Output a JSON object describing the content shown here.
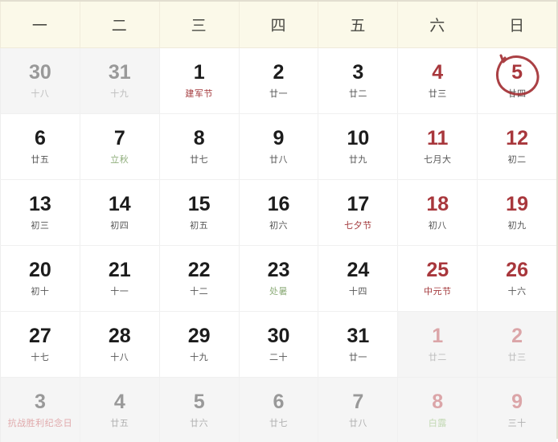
{
  "calendar": {
    "weekdays": [
      "一",
      "二",
      "三",
      "四",
      "五",
      "六",
      "日"
    ],
    "colors": {
      "header_bg": "#fbf9e9",
      "weekend_red": "#a8373c",
      "festival_red": "#a3393c",
      "solarterm_green": "#8fae7c",
      "other_month_bg": "#f5f5f5",
      "highlight_circle": "#a33034"
    },
    "highlight": {
      "day": "5",
      "type": "circle-annotation"
    },
    "weeks": [
      [
        {
          "num": "30",
          "sub": "十八",
          "num_style": "muted",
          "sub_style": "muted",
          "other_month": true,
          "marked": false
        },
        {
          "num": "31",
          "sub": "十九",
          "num_style": "muted",
          "sub_style": "muted",
          "other_month": true,
          "marked": false
        },
        {
          "num": "1",
          "sub": "建军节",
          "num_style": "normal",
          "sub_style": "festival",
          "other_month": false,
          "marked": false
        },
        {
          "num": "2",
          "sub": "廿一",
          "num_style": "normal",
          "sub_style": "plain",
          "other_month": false,
          "marked": false
        },
        {
          "num": "3",
          "sub": "廿二",
          "num_style": "normal",
          "sub_style": "plain",
          "other_month": false,
          "marked": false
        },
        {
          "num": "4",
          "sub": "廿三",
          "num_style": "weekend",
          "sub_style": "plain",
          "other_month": false,
          "marked": false
        },
        {
          "num": "5",
          "sub": "廿四",
          "num_style": "weekend",
          "sub_style": "plain",
          "other_month": false,
          "marked": true
        }
      ],
      [
        {
          "num": "6",
          "sub": "廿五",
          "num_style": "normal",
          "sub_style": "plain",
          "other_month": false,
          "marked": false
        },
        {
          "num": "7",
          "sub": "立秋",
          "num_style": "normal",
          "sub_style": "solarterm",
          "other_month": false,
          "marked": false
        },
        {
          "num": "8",
          "sub": "廿七",
          "num_style": "normal",
          "sub_style": "plain",
          "other_month": false,
          "marked": false
        },
        {
          "num": "9",
          "sub": "廿八",
          "num_style": "normal",
          "sub_style": "plain",
          "other_month": false,
          "marked": false
        },
        {
          "num": "10",
          "sub": "廿九",
          "num_style": "normal",
          "sub_style": "plain",
          "other_month": false,
          "marked": false
        },
        {
          "num": "11",
          "sub": "七月大",
          "num_style": "weekend",
          "sub_style": "plain",
          "other_month": false,
          "marked": false
        },
        {
          "num": "12",
          "sub": "初二",
          "num_style": "weekend",
          "sub_style": "plain",
          "other_month": false,
          "marked": false
        }
      ],
      [
        {
          "num": "13",
          "sub": "初三",
          "num_style": "normal",
          "sub_style": "plain",
          "other_month": false,
          "marked": false
        },
        {
          "num": "14",
          "sub": "初四",
          "num_style": "normal",
          "sub_style": "plain",
          "other_month": false,
          "marked": false
        },
        {
          "num": "15",
          "sub": "初五",
          "num_style": "normal",
          "sub_style": "plain",
          "other_month": false,
          "marked": false
        },
        {
          "num": "16",
          "sub": "初六",
          "num_style": "normal",
          "sub_style": "plain",
          "other_month": false,
          "marked": false
        },
        {
          "num": "17",
          "sub": "七夕节",
          "num_style": "normal",
          "sub_style": "festival",
          "other_month": false,
          "marked": false
        },
        {
          "num": "18",
          "sub": "初八",
          "num_style": "weekend",
          "sub_style": "plain",
          "other_month": false,
          "marked": false
        },
        {
          "num": "19",
          "sub": "初九",
          "num_style": "weekend",
          "sub_style": "plain",
          "other_month": false,
          "marked": false
        }
      ],
      [
        {
          "num": "20",
          "sub": "初十",
          "num_style": "normal",
          "sub_style": "plain",
          "other_month": false,
          "marked": false
        },
        {
          "num": "21",
          "sub": "十一",
          "num_style": "normal",
          "sub_style": "plain",
          "other_month": false,
          "marked": false
        },
        {
          "num": "22",
          "sub": "十二",
          "num_style": "normal",
          "sub_style": "plain",
          "other_month": false,
          "marked": false
        },
        {
          "num": "23",
          "sub": "处暑",
          "num_style": "normal",
          "sub_style": "solarterm",
          "other_month": false,
          "marked": false
        },
        {
          "num": "24",
          "sub": "十四",
          "num_style": "normal",
          "sub_style": "plain",
          "other_month": false,
          "marked": false
        },
        {
          "num": "25",
          "sub": "中元节",
          "num_style": "weekend",
          "sub_style": "festival",
          "other_month": false,
          "marked": false
        },
        {
          "num": "26",
          "sub": "十六",
          "num_style": "weekend",
          "sub_style": "plain",
          "other_month": false,
          "marked": false
        }
      ],
      [
        {
          "num": "27",
          "sub": "十七",
          "num_style": "normal",
          "sub_style": "plain",
          "other_month": false,
          "marked": false
        },
        {
          "num": "28",
          "sub": "十八",
          "num_style": "normal",
          "sub_style": "plain",
          "other_month": false,
          "marked": false
        },
        {
          "num": "29",
          "sub": "十九",
          "num_style": "normal",
          "sub_style": "plain",
          "other_month": false,
          "marked": false
        },
        {
          "num": "30",
          "sub": "二十",
          "num_style": "normal",
          "sub_style": "plain",
          "other_month": false,
          "marked": false
        },
        {
          "num": "31",
          "sub": "廿一",
          "num_style": "normal",
          "sub_style": "plain",
          "other_month": false,
          "marked": false
        },
        {
          "num": "1",
          "sub": "廿二",
          "num_style": "muted-weekend",
          "sub_style": "muted",
          "other_month": true,
          "marked": false
        },
        {
          "num": "2",
          "sub": "廿三",
          "num_style": "muted-weekend",
          "sub_style": "muted",
          "other_month": true,
          "marked": false
        }
      ],
      [
        {
          "num": "3",
          "sub": "抗战胜利纪念日",
          "num_style": "muted",
          "sub_style": "muted-festival",
          "other_month": true,
          "marked": false
        },
        {
          "num": "4",
          "sub": "廿五",
          "num_style": "muted",
          "sub_style": "muted-plain",
          "other_month": true,
          "marked": false
        },
        {
          "num": "5",
          "sub": "廿六",
          "num_style": "muted",
          "sub_style": "muted-plain",
          "other_month": true,
          "marked": false
        },
        {
          "num": "6",
          "sub": "廿七",
          "num_style": "muted",
          "sub_style": "muted-plain",
          "other_month": true,
          "marked": false
        },
        {
          "num": "7",
          "sub": "廿八",
          "num_style": "muted",
          "sub_style": "muted-plain",
          "other_month": true,
          "marked": false
        },
        {
          "num": "8",
          "sub": "白露",
          "num_style": "muted-weekend",
          "sub_style": "muted-solarterm",
          "other_month": true,
          "marked": false
        },
        {
          "num": "9",
          "sub": "三十",
          "num_style": "muted-weekend",
          "sub_style": "muted-plain",
          "other_month": true,
          "marked": false
        }
      ]
    ]
  }
}
